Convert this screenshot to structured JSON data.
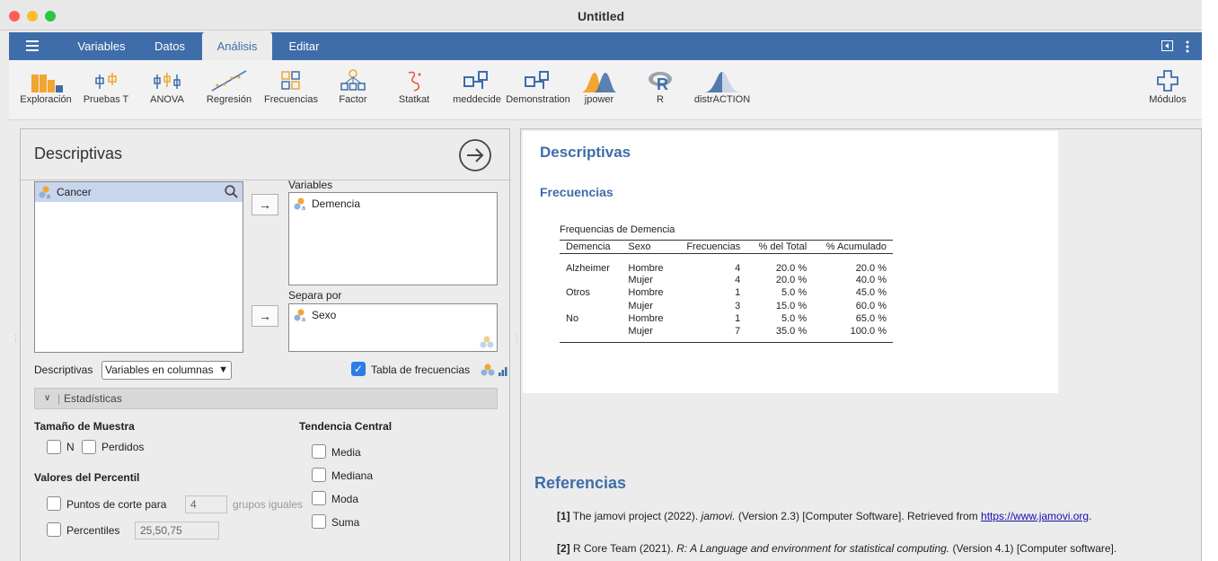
{
  "window": {
    "title": "Untitled"
  },
  "tabs": [
    {
      "label": "Variables"
    },
    {
      "label": "Datos"
    },
    {
      "label": "Análisis"
    },
    {
      "label": "Editar"
    }
  ],
  "ribbon": [
    {
      "label": "Exploración",
      "icon": "bar-chart-icon"
    },
    {
      "label": "Pruebas T",
      "icon": "t-test-icon"
    },
    {
      "label": "ANOVA",
      "icon": "anova-icon"
    },
    {
      "label": "Regresión",
      "icon": "regression-icon"
    },
    {
      "label": "Frecuencias",
      "icon": "frequencies-icon"
    },
    {
      "label": "Factor",
      "icon": "factor-icon"
    },
    {
      "label": "Statkat",
      "icon": "statkat-icon"
    },
    {
      "label": "meddecide",
      "icon": "meddecide-icon"
    },
    {
      "label": "Demonstration",
      "icon": "demonstration-icon"
    },
    {
      "label": "jpower",
      "icon": "jpower-icon"
    },
    {
      "label": "R",
      "icon": "r-logo-icon"
    },
    {
      "label": "distrACTION",
      "icon": "distraction-icon"
    },
    {
      "label": "Módulos",
      "icon": "plus-icon"
    }
  ],
  "analysis": {
    "title": "Descriptivas",
    "source_vars": [
      "Cancer"
    ],
    "variables_label": "Variables",
    "variables": [
      "Demencia"
    ],
    "split_label": "Separa por",
    "split_vars": [
      "Sexo"
    ],
    "descriptivas_label": "Descriptivas",
    "descriptivas_select": "Variables en columnas",
    "freq_table_label": "Tabla de frecuencias",
    "freq_table_checked": true,
    "stats_section": "Estadísticas",
    "sample_size": {
      "heading": "Tamaño de Muestra",
      "n": "N",
      "missing": "Perdidos"
    },
    "percentile": {
      "heading": "Valores del Percentil",
      "cut_label": "Puntos de corte para",
      "cut_value": "4",
      "cut_suffix": "grupos iguales",
      "pct_label": "Percentiles",
      "pct_value": "25,50,75"
    },
    "central": {
      "heading": "Tendencia Central",
      "mean": "Media",
      "median": "Mediana",
      "mode": "Moda",
      "sum": "Suma"
    }
  },
  "results": {
    "title": "Descriptivas",
    "subtitle": "Frecuencias",
    "table_title": "Frequencias de Demencia",
    "columns": [
      "Demencia",
      "Sexo",
      "Frecuencias",
      "% del Total",
      "% Acumulado"
    ],
    "rows": [
      [
        "Alzheimer",
        "Hombre",
        "4",
        "20.0 %",
        "20.0 %"
      ],
      [
        "",
        "Mujer",
        "4",
        "20.0 %",
        "40.0 %"
      ],
      [
        "Otros",
        "Hombre",
        "1",
        "5.0 %",
        "45.0 %"
      ],
      [
        "",
        "Mujer",
        "3",
        "15.0 %",
        "60.0 %"
      ],
      [
        "No",
        "Hombre",
        "1",
        "5.0 %",
        "65.0 %"
      ],
      [
        "",
        "Mujer",
        "7",
        "35.0 %",
        "100.0 %"
      ]
    ],
    "references_title": "Referencias",
    "ref1": {
      "num": "[1]",
      "pre": "The jamovi project (2022).",
      "italic": "jamovi.",
      "post": "(Version 2.3) [Computer Software]. Retrieved from",
      "link": "https://www.jamovi.org",
      "end": "."
    },
    "ref2": {
      "num": "[2]",
      "pre": "R Core Team (2021).",
      "italic": "R: A Language and environment for statistical computing.",
      "post": "(Version 4.1) [Computer software]."
    }
  },
  "colors": {
    "accent": "#3e6da9",
    "heading": "#3e6da9",
    "ribbon_orange": "#f0a630",
    "ribbon_blue": "#3e6da9"
  }
}
